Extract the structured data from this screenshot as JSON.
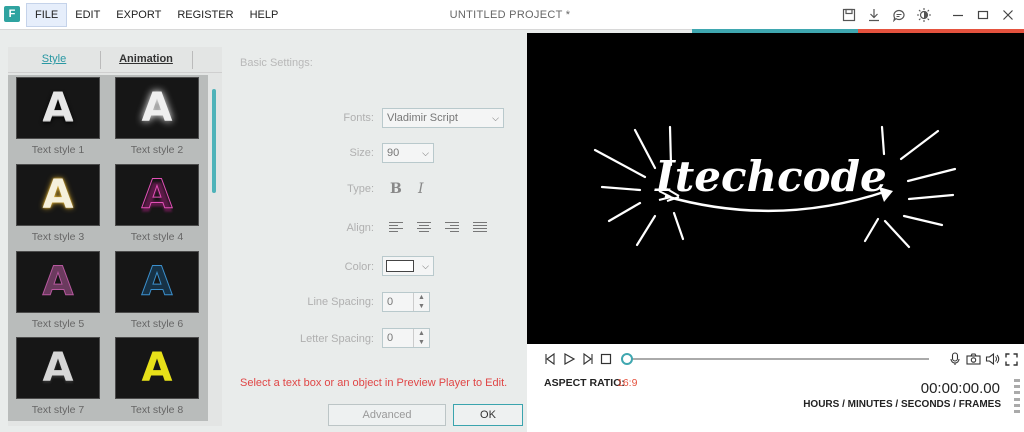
{
  "app": {
    "logo_letter": "F",
    "title": "UNTITLED PROJECT *",
    "menu": [
      {
        "label": "FILE",
        "active": true
      },
      {
        "label": "EDIT",
        "active": false
      },
      {
        "label": "EXPORT",
        "active": false
      },
      {
        "label": "REGISTER",
        "active": false
      },
      {
        "label": "HELP",
        "active": false
      }
    ],
    "title_icons": [
      "save-icon",
      "download-icon",
      "feedback-icon",
      "brightness-icon",
      "minimize-icon",
      "maximize-icon",
      "close-icon"
    ],
    "accent_colors": {
      "teal": "#3fa7b0",
      "red": "#e5523e"
    }
  },
  "style_panel": {
    "tabs": [
      {
        "label": "Style",
        "active": true
      },
      {
        "label": "Animation",
        "active": false
      }
    ],
    "tiles": [
      {
        "glyph": "A",
        "label": "Text style 1"
      },
      {
        "glyph": "A",
        "label": "Text style 2"
      },
      {
        "glyph": "A",
        "label": "Text style 3"
      },
      {
        "glyph": "A",
        "label": "Text style 4"
      },
      {
        "glyph": "A",
        "label": "Text style 5"
      },
      {
        "glyph": "A",
        "label": "Text style 6"
      },
      {
        "glyph": "A",
        "label": "Text style 7"
      },
      {
        "glyph": "A",
        "label": "Text style 8"
      }
    ]
  },
  "settings": {
    "section_title": "Basic Settings:",
    "fonts_label": "Fonts:",
    "font_value": "Vladimir Script",
    "size_label": "Size:",
    "size_value": "90",
    "type_label": "Type:",
    "bold_glyph": "B",
    "italic_glyph": "I",
    "align_label": "Align:",
    "color_label": "Color:",
    "color_value": "#ffffff",
    "line_spacing_label": "Line Spacing:",
    "line_spacing_value": "0",
    "letter_spacing_label": "Letter Spacing:",
    "letter_spacing_value": "0",
    "warning": "Select a text box or an object in Preview Player to Edit.",
    "advanced_label": "Advanced",
    "ok_label": "OK"
  },
  "preview": {
    "caption_text": "Itechcode",
    "aspect_label": "ASPECT RATIO:",
    "aspect_value": "16:9",
    "timecode": "00:00:00.00",
    "time_units": "HOURS / MINUTES / SECONDS / FRAMES",
    "progress": 0
  }
}
